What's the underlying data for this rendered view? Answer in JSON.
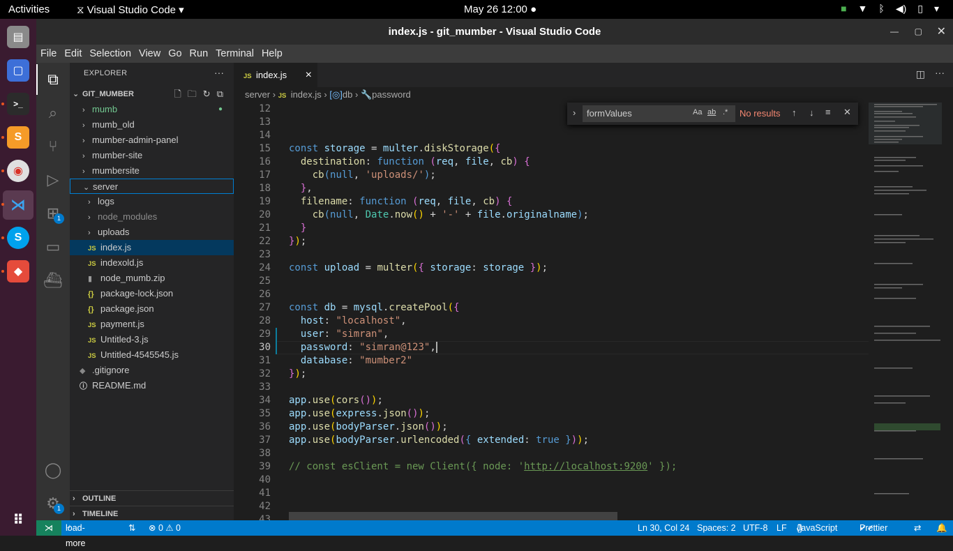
{
  "topbar": {
    "activities": "Activities",
    "app_name": "Visual Studio Code",
    "clock": "May 26  12:00"
  },
  "window": {
    "title": "index.js - git_mumber - Visual Studio Code"
  },
  "menu": [
    "File",
    "Edit",
    "Selection",
    "View",
    "Go",
    "Run",
    "Terminal",
    "Help"
  ],
  "activity_badges": {
    "extensions": "1",
    "settings": "1"
  },
  "explorer": {
    "header": "EXPLORER",
    "more": "···",
    "root": "GIT_MUMBER",
    "items": [
      {
        "label": "mumb",
        "type": "folder",
        "depth": 1,
        "color": "#73c991"
      },
      {
        "label": "mumb_old",
        "type": "folder",
        "depth": 1
      },
      {
        "label": "mumber-admin-panel",
        "type": "folder",
        "depth": 1
      },
      {
        "label": "mumber-site",
        "type": "folder",
        "depth": 1
      },
      {
        "label": "mumbersite",
        "type": "folder",
        "depth": 1
      },
      {
        "label": "server",
        "type": "folder-open",
        "depth": 1
      },
      {
        "label": "logs",
        "type": "folder",
        "depth": 2
      },
      {
        "label": "node_modules",
        "type": "folder",
        "depth": 2,
        "color": "#8c8c8c"
      },
      {
        "label": "uploads",
        "type": "folder",
        "depth": 2
      },
      {
        "label": "index.js",
        "type": "js",
        "depth": 2
      },
      {
        "label": "indexold.js",
        "type": "js",
        "depth": 2
      },
      {
        "label": "node_mumb.zip",
        "type": "zip",
        "depth": 2
      },
      {
        "label": "package-lock.json",
        "type": "json",
        "depth": 2
      },
      {
        "label": "package.json",
        "type": "json",
        "depth": 2
      },
      {
        "label": "payment.js",
        "type": "js",
        "depth": 2
      },
      {
        "label": "Untitled-3.js",
        "type": "js",
        "depth": 2
      },
      {
        "label": "Untitled-4545545.js",
        "type": "js",
        "depth": 2
      },
      {
        "label": ".gitignore",
        "type": "git",
        "depth": 1
      },
      {
        "label": "README.md",
        "type": "info",
        "depth": 1
      }
    ],
    "outline": "OUTLINE",
    "timeline": "TIMELINE"
  },
  "tab": {
    "icon": "JS",
    "label": "index.js",
    "close": "×"
  },
  "breadcrumb": {
    "folder": "server",
    "file": "index.js",
    "symbol1": "db",
    "symbol2": "password"
  },
  "find": {
    "value": "formValues",
    "opt_case": "Aa",
    "opt_word": "ab",
    "opt_regex": ".*",
    "result": "No results"
  },
  "editor": {
    "current_line": 30
  },
  "status": {
    "branch": "load-more",
    "problems": "⊗ 0 ⚠ 0",
    "position": "Ln 30, Col 24",
    "spaces": "Spaces: 2",
    "encoding": "UTF-8",
    "eol": "LF",
    "language": "JavaScript",
    "formatter": "Prettier"
  }
}
